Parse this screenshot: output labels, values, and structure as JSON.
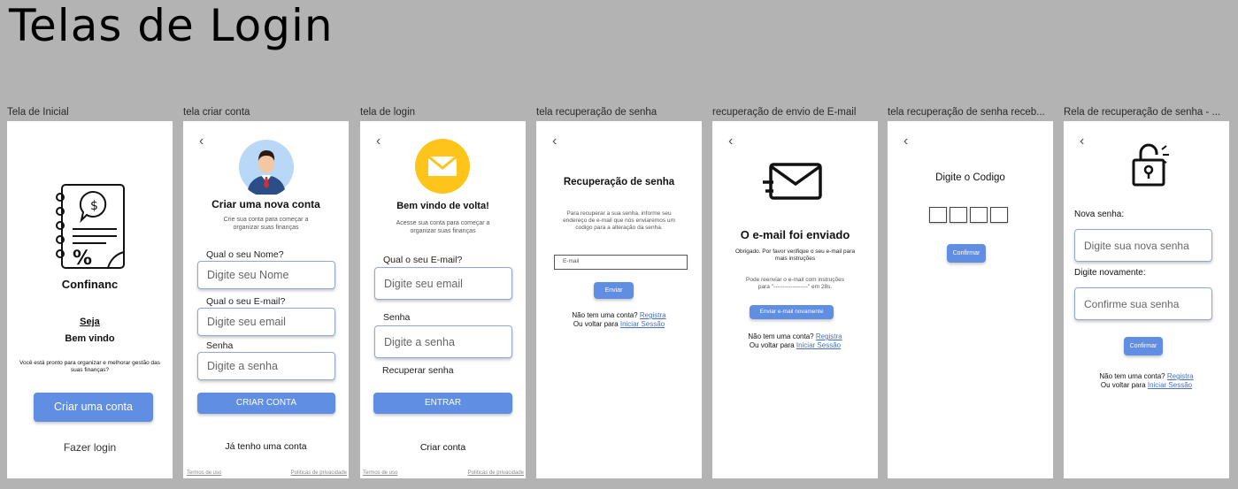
{
  "board": {
    "title": "Telas de Login"
  },
  "frames": {
    "inicial": {
      "label": "Tela de Inicial",
      "app_name": "Confinanc",
      "welcome_1": "Seja",
      "welcome_2": "Bem vindo",
      "description": "Você está pronto para organizar e melhorar gestão das suas finanças?",
      "create_button": "Criar uma conta",
      "login_link": "Fazer login"
    },
    "criar": {
      "label": "tela criar conta",
      "back": "‹",
      "heading": "Criar uma nova conta",
      "subheading": "Crie sua conta para começar a organizar suas finanças",
      "name_label": "Qual o seu Nome?",
      "name_placeholder": "Digite seu Nome",
      "email_label": "Qual o seu E-mail?",
      "email_placeholder": "Digite seu email",
      "password_label": "Senha",
      "password_placeholder": "Digite a senha",
      "submit": "CRIAR CONTA",
      "have_account": "Já tenho uma conta",
      "terms": "Termos de uso",
      "privacy": "Políticas de privacidade"
    },
    "login": {
      "label": "tela de login",
      "back": "‹",
      "heading": "Bem vindo de volta!",
      "subheading": "Acesse sua conta para começar a organizar suas finanças",
      "email_label": "Qual o seu E-mail?",
      "email_placeholder": "Digite seu email",
      "password_label": "Senha",
      "password_placeholder": "Digite a senha",
      "recover": "Recuperar senha",
      "submit": "ENTRAR",
      "create": "Criar conta",
      "terms": "Termos de uso",
      "privacy": "Políticas de privacidade"
    },
    "recuperacao": {
      "label": "tela recuperação de senha",
      "back": "‹",
      "heading": "Recuperação de senha",
      "description": "Para recuperar a sua senha, informe seu endereço de e-mail que nós enviaremos um codigo para a alteração da senha.",
      "email_placeholder": "E-mail",
      "send": "Enviar",
      "no_account": "Não tem uma conta?",
      "register": "Registra",
      "or_back": "Ou voltar para",
      "sign_in": "Iniciar Sessão"
    },
    "enviado": {
      "label": "recuperação de envio de E-mail",
      "back": "‹",
      "heading": "O e-mail foi enviado",
      "thanks": "Obrigado. Por favor verifique o seu e-mail para mais instruções",
      "resend_info_1": "Pode  reenviar o e-mail com instruções",
      "resend_info_2": "para \"------------------\" em 28s.",
      "resend_button": "Enviar e-mail novamente",
      "no_account": "Não tem uma conta?",
      "register": "Registra",
      "or_back": "Ou voltar para",
      "sign_in": "Iniciar Sessão"
    },
    "codigo": {
      "label": "tela recuperação de senha receb...",
      "back": "‹",
      "heading": "Digite o Codigo",
      "confirm": "Confirmar"
    },
    "nova": {
      "label": "Rela de recuperação de senha - ...",
      "back": "‹",
      "new_label": "Nova senha:",
      "new_placeholder": "Digite  sua nova senha",
      "again_label": "Digite novamente:",
      "again_placeholder": "Confirme sua senha",
      "confirm": "Confirmar",
      "no_account": "Não tem uma conta?",
      "register": "Registra",
      "or_back": "Ou voltar para",
      "sign_in": "Iniciar Sessão"
    }
  },
  "colors": {
    "background": "#b3b3b3",
    "primary": "#5f8ee3",
    "envelope_circle": "#ffc41a",
    "avatar_circle": "#b9d8f7"
  }
}
